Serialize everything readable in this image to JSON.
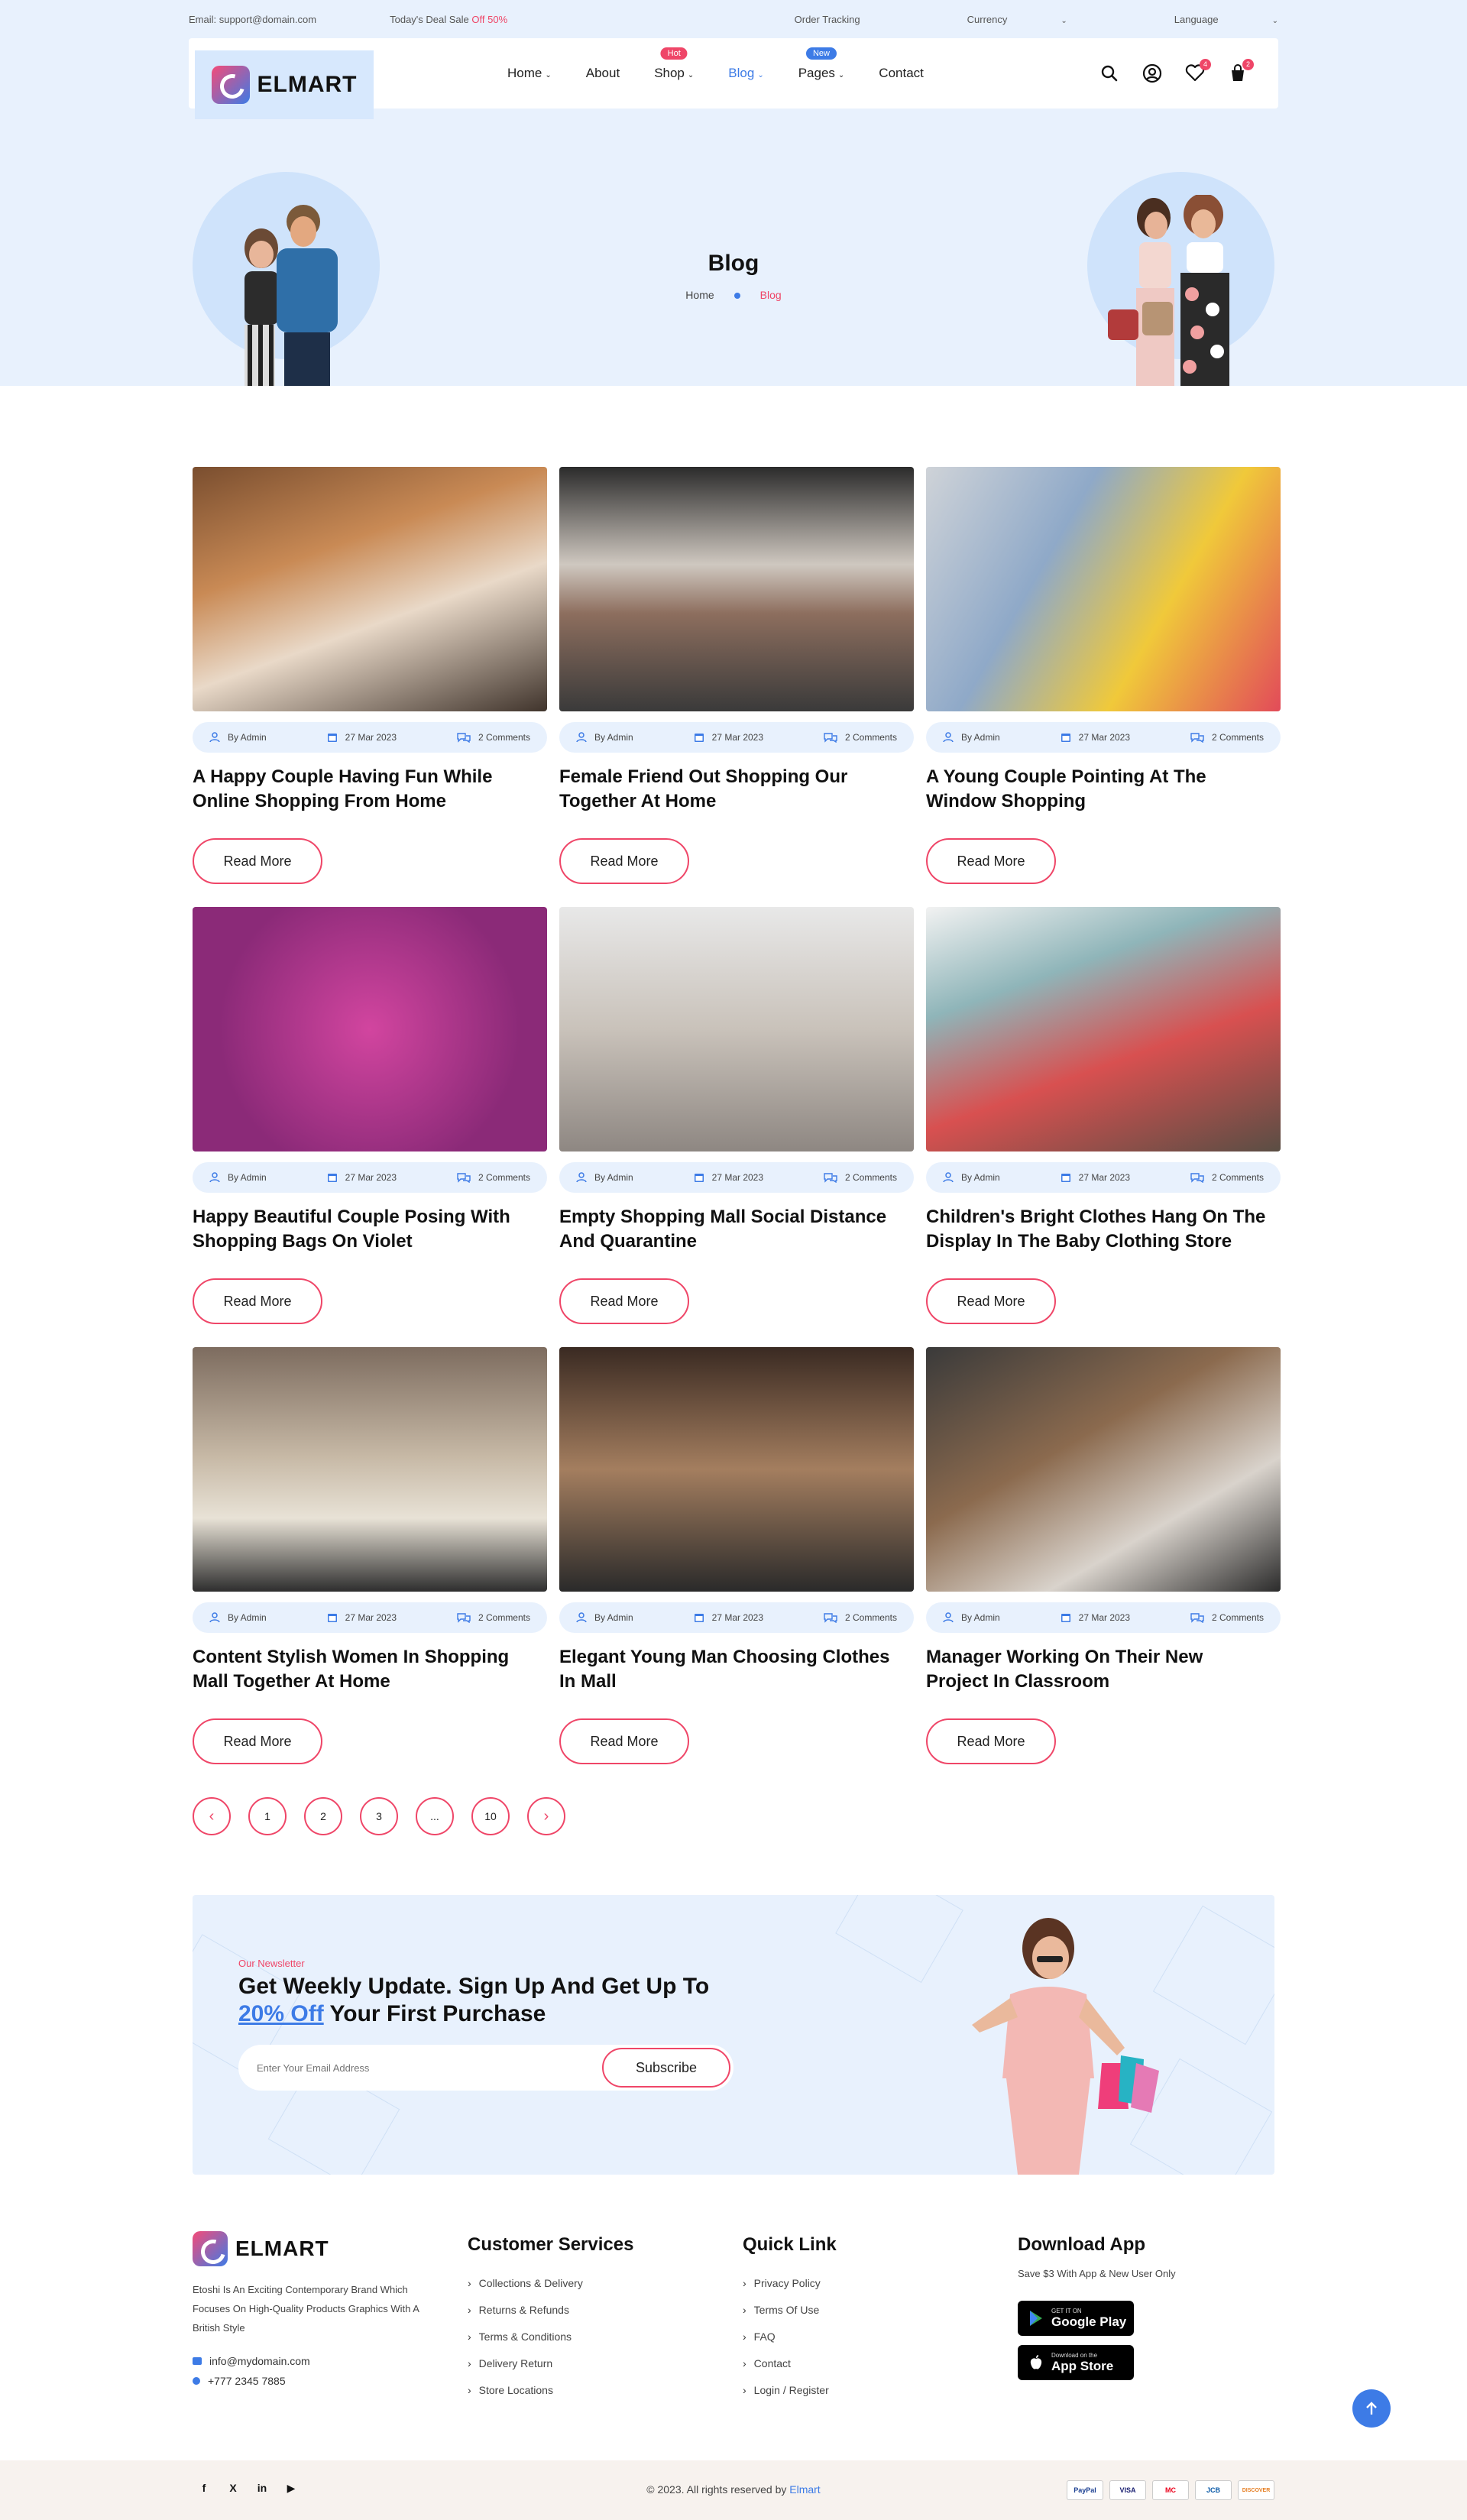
{
  "topbar": {
    "email": "Email: support@domain.com",
    "deal_prefix": "Today's Deal Sale",
    "deal_off": "Off 50%",
    "order_tracking": "Order Tracking",
    "currency": "Currency",
    "language": "Language"
  },
  "header": {
    "logo_text": "ELMART",
    "menu": [
      {
        "label": "Home",
        "has_dropdown": true
      },
      {
        "label": "About"
      },
      {
        "label": "Shop",
        "has_dropdown": true,
        "badge": "Hot"
      },
      {
        "label": "Blog",
        "has_dropdown": true,
        "active": true
      },
      {
        "label": "Pages",
        "has_dropdown": true,
        "badge": "New"
      },
      {
        "label": "Contact"
      }
    ],
    "wishlist_count": "4",
    "cart_count": "2",
    "accent": "#3d7be6",
    "brand": "#ef4668"
  },
  "hero": {
    "title": "Blog",
    "crumb_home": "Home",
    "crumb_current": "Blog"
  },
  "posts": [
    {
      "author": "By Admin",
      "date": "27 Mar 2023",
      "comments": "2 Comments",
      "title": "A Happy Couple Having Fun While Online Shopping From Home",
      "cta": "Read More"
    },
    {
      "author": "By Admin",
      "date": "27 Mar 2023",
      "comments": "2 Comments",
      "title": "Female Friend Out Shopping Our Together At Home",
      "cta": "Read More"
    },
    {
      "author": "By Admin",
      "date": "27 Mar 2023",
      "comments": "2 Comments",
      "title": "A Young Couple Pointing At The Window Shopping",
      "cta": "Read More"
    },
    {
      "author": "By Admin",
      "date": "27 Mar 2023",
      "comments": "2 Comments",
      "title": "Happy Beautiful Couple Posing With Shopping Bags On Violet",
      "cta": "Read More"
    },
    {
      "author": "By Admin",
      "date": "27 Mar 2023",
      "comments": "2 Comments",
      "title": "Empty Shopping Mall Social Distance And Quarantine",
      "cta": "Read More"
    },
    {
      "author": "By Admin",
      "date": "27 Mar 2023",
      "comments": "2 Comments",
      "title": "Children's Bright Clothes Hang On The Display In The Baby Clothing Store",
      "cta": "Read More"
    },
    {
      "author": "By Admin",
      "date": "27 Mar 2023",
      "comments": "2 Comments",
      "title": "Content Stylish Women In Shopping Mall Together At Home",
      "cta": "Read More"
    },
    {
      "author": "By Admin",
      "date": "27 Mar 2023",
      "comments": "2 Comments",
      "title": "Elegant Young Man Choosing Clothes In Mall",
      "cta": "Read More"
    },
    {
      "author": "By Admin",
      "date": "27 Mar 2023",
      "comments": "2 Comments",
      "title": "Manager Working On Their New Project In Classroom",
      "cta": "Read More"
    }
  ],
  "pagination": [
    "‹",
    "1",
    "2",
    "3",
    "...",
    "10",
    "›"
  ],
  "newsletter": {
    "eyebrow": "Our Newsletter",
    "title_line1": "Get Weekly Update. Sign Up And Get Up To",
    "title_off": "20% Off",
    "title_line2_rest": " Your First Purchase",
    "placeholder": "Enter Your Email Address",
    "button": "Subscribe"
  },
  "footer": {
    "logo_text": "ELMART",
    "description": "Etoshi Is An Exciting Contemporary Brand Which Focuses On High-Quality Products Graphics With A British Style",
    "email": "info@mydomain.com",
    "phone": "+777 2345 7885",
    "customer_services": {
      "title": "Customer Services",
      "items": [
        "Collections & Delivery",
        "Returns & Refunds",
        "Terms & Conditions",
        "Delivery Return",
        "Store Locations"
      ]
    },
    "quick_link": {
      "title": "Quick Link",
      "items": [
        "Privacy Policy",
        "Terms Of Use",
        "FAQ",
        "Contact",
        "Login / Register"
      ]
    },
    "download": {
      "title": "Download App",
      "subtitle": "Save $3 With App & New User Only",
      "google_small": "GET IT ON",
      "google_big": "Google Play",
      "apple_small": "Download on the",
      "apple_big": "App Store"
    }
  },
  "bottom": {
    "copyright_prefix": "© 2023. All rights reserved by",
    "copyright_brand": "Elmart",
    "socials": [
      "f",
      "X",
      "in",
      "▶"
    ],
    "payments": [
      "PayPal",
      "VISA",
      "MC",
      "JCB",
      "DISCOVER"
    ]
  }
}
